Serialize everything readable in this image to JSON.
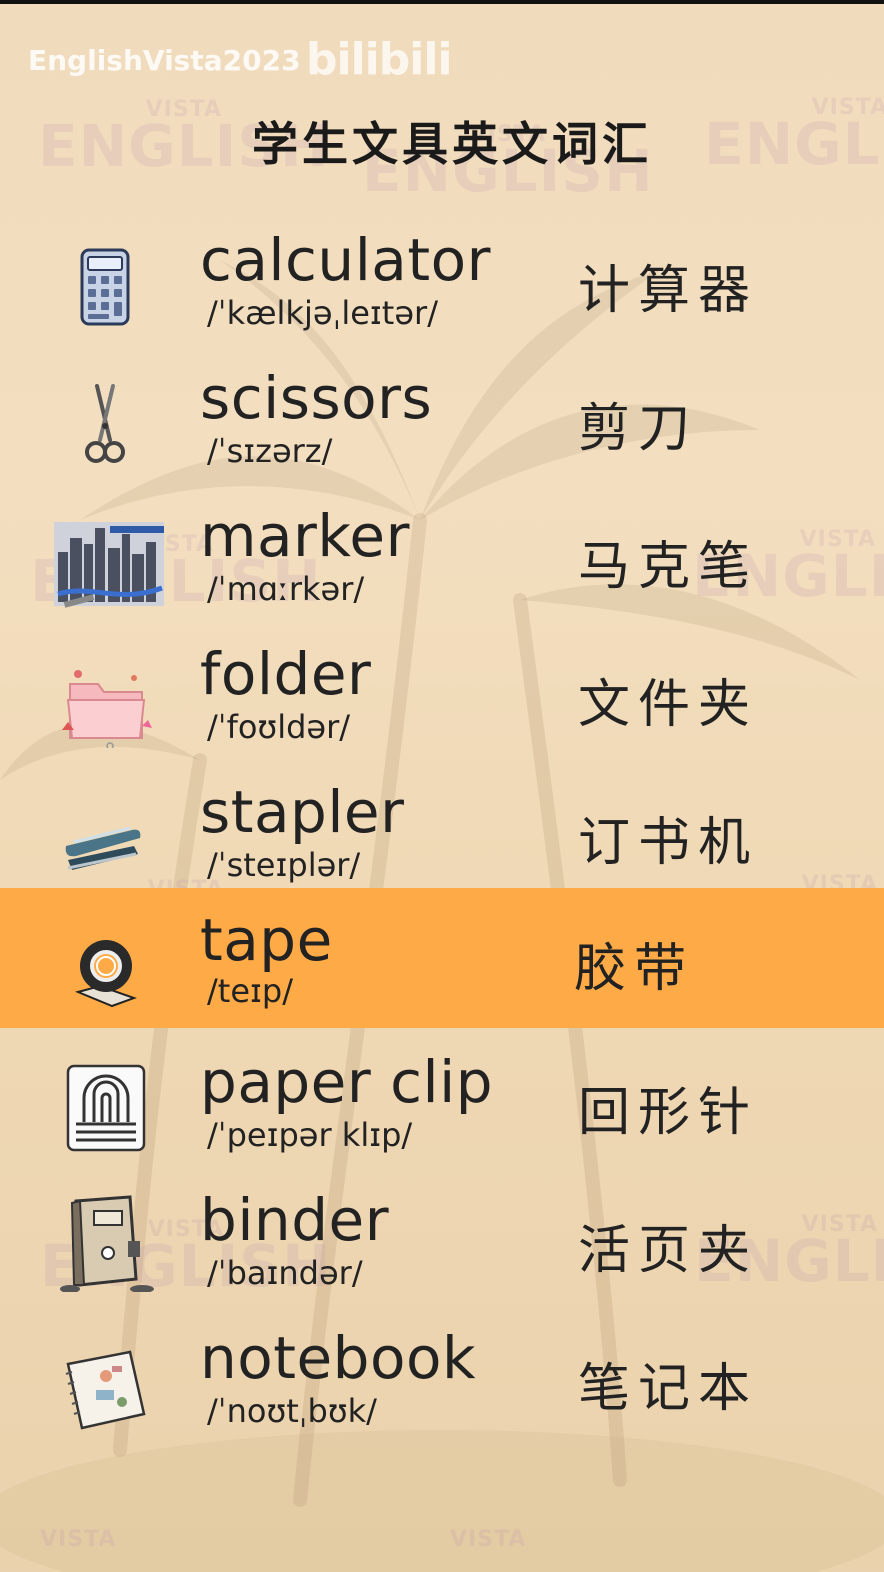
{
  "channel": "EnglishVista2023",
  "platform_logo": "bilibili",
  "title": "学生文具英文词汇",
  "watermark": {
    "line1": "VISTA",
    "line2": "ENGLISH"
  },
  "highlight_color": "#fdaa47",
  "vocab": [
    {
      "word": "calculator",
      "ipa": "/ˈkælkjəˌleɪtər/",
      "chinese": "计算器",
      "icon": "calculator-icon"
    },
    {
      "word": "scissors",
      "ipa": "/ˈsɪzərz/",
      "chinese": "剪刀",
      "icon": "scissors-icon"
    },
    {
      "word": "marker",
      "ipa": "/ˈmɑːrkər/",
      "chinese": "马克笔",
      "icon": "marker-icon"
    },
    {
      "word": "folder",
      "ipa": "/ˈfoʊldər/",
      "chinese": "文件夹",
      "icon": "folder-icon"
    },
    {
      "word": "stapler",
      "ipa": "/ˈsteɪplər/",
      "chinese": "订书机",
      "icon": "stapler-icon"
    },
    {
      "word": "tape",
      "ipa": "/teɪp/",
      "chinese": "胶带",
      "icon": "tape-icon",
      "highlighted": true
    },
    {
      "word": "paper clip",
      "ipa": "/ˈpeɪpər klɪp/",
      "chinese": "回形针",
      "icon": "paper-clip-icon"
    },
    {
      "word": "binder",
      "ipa": "/ˈbaɪndər/",
      "chinese": "活页夹",
      "icon": "binder-icon"
    },
    {
      "word": "notebook",
      "ipa": "/ˈnoʊtˌbʊk/",
      "chinese": "笔记本",
      "icon": "notebook-icon"
    }
  ]
}
